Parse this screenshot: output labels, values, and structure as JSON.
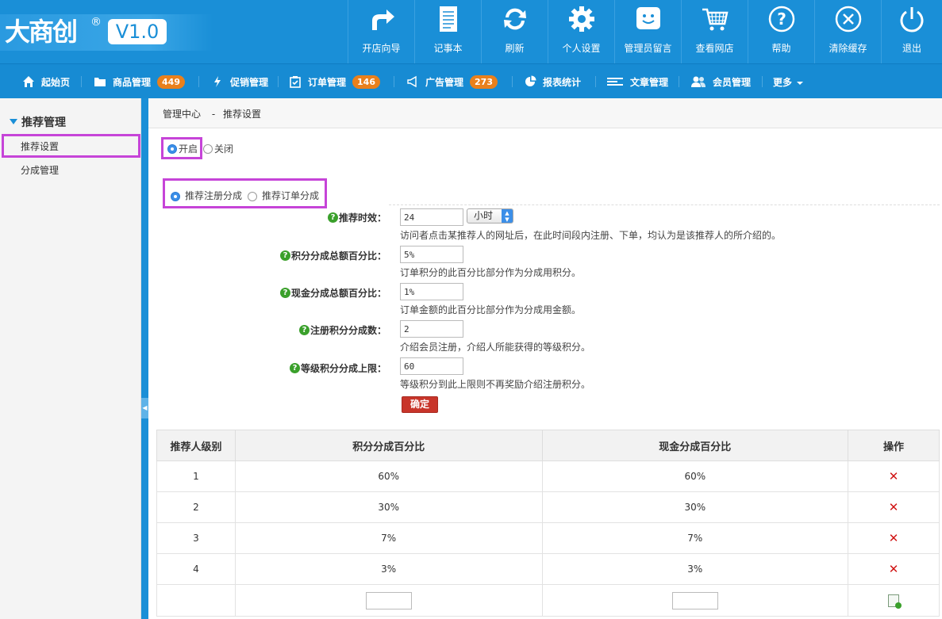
{
  "header": {
    "brand": "大商创",
    "reg_mark": "®",
    "version": "V1.0",
    "tools": [
      {
        "label": "开店向导",
        "icon": "share-arrow-icon"
      },
      {
        "label": "记事本",
        "icon": "notepad-icon"
      },
      {
        "label": "刷新",
        "icon": "refresh-icon"
      },
      {
        "label": "个人设置",
        "icon": "gear-icon"
      },
      {
        "label": "管理员留言",
        "icon": "message-face-icon"
      },
      {
        "label": "查看网店",
        "icon": "shopping-cart-icon"
      },
      {
        "label": "帮助",
        "icon": "help-icon"
      },
      {
        "label": "清除缓存",
        "icon": "clear-cache-icon"
      },
      {
        "label": "退出",
        "icon": "power-icon"
      }
    ]
  },
  "nav": {
    "items": [
      {
        "label": "起始页",
        "icon": "home-icon"
      },
      {
        "label": "商品管理",
        "icon": "folder-icon",
        "badge": "449"
      },
      {
        "label": "促销管理",
        "icon": "lightning-icon"
      },
      {
        "label": "订单管理",
        "icon": "clipboard-icon",
        "badge": "146"
      },
      {
        "label": "广告管理",
        "icon": "megaphone-icon",
        "badge": "273"
      },
      {
        "label": "报表统计",
        "icon": "pie-chart-icon"
      },
      {
        "label": "文章管理",
        "icon": "list-lines-icon"
      },
      {
        "label": "会员管理",
        "icon": "users-icon"
      },
      {
        "label": "更多",
        "icon": "caret-down-icon"
      }
    ]
  },
  "sidebar": {
    "group": "推荐管理",
    "items": [
      "推荐设置",
      "分成管理"
    ]
  },
  "breadcrumb": {
    "root": "管理中心",
    "sep": "-",
    "current": "推荐设置"
  },
  "status_radio": {
    "on": "开启",
    "off": "关闭"
  },
  "mode_radio": {
    "register": "推荐注册分成",
    "order": "推荐订单分成"
  },
  "form": {
    "validity": {
      "label": "推荐时效：",
      "value": "24",
      "unit": "小时",
      "hint": "访问者点击某推荐人的网址后，在此时间段内注册、下单，均认为是该推荐人的所介绍的。"
    },
    "points_percent": {
      "label": "积分分成总额百分比：",
      "value": "5%",
      "hint": "订单积分的此百分比部分作为分成用积分。"
    },
    "cash_percent": {
      "label": "现金分成总额百分比：",
      "value": "1%",
      "hint": "订单金额的此百分比部分作为分成用金额。"
    },
    "register_points": {
      "label": "注册积分分成数：",
      "value": "2",
      "hint": "介绍会员注册，介绍人所能获得的等级积分。"
    },
    "rank_points_limit": {
      "label": "等级积分分成上限：",
      "value": "60",
      "hint": "等级积分到此上限则不再奖励介绍注册积分。"
    },
    "submit": "确定"
  },
  "table": {
    "headers": [
      "推荐人级别",
      "积分分成百分比",
      "现金分成百分比",
      "操作"
    ],
    "rows": [
      {
        "level": "1",
        "points": "60%",
        "cash": "60%"
      },
      {
        "level": "2",
        "points": "30%",
        "cash": "30%"
      },
      {
        "level": "3",
        "points": "7%",
        "cash": "7%"
      },
      {
        "level": "4",
        "points": "3%",
        "cash": "3%"
      }
    ],
    "delete_glyph": "✕"
  }
}
